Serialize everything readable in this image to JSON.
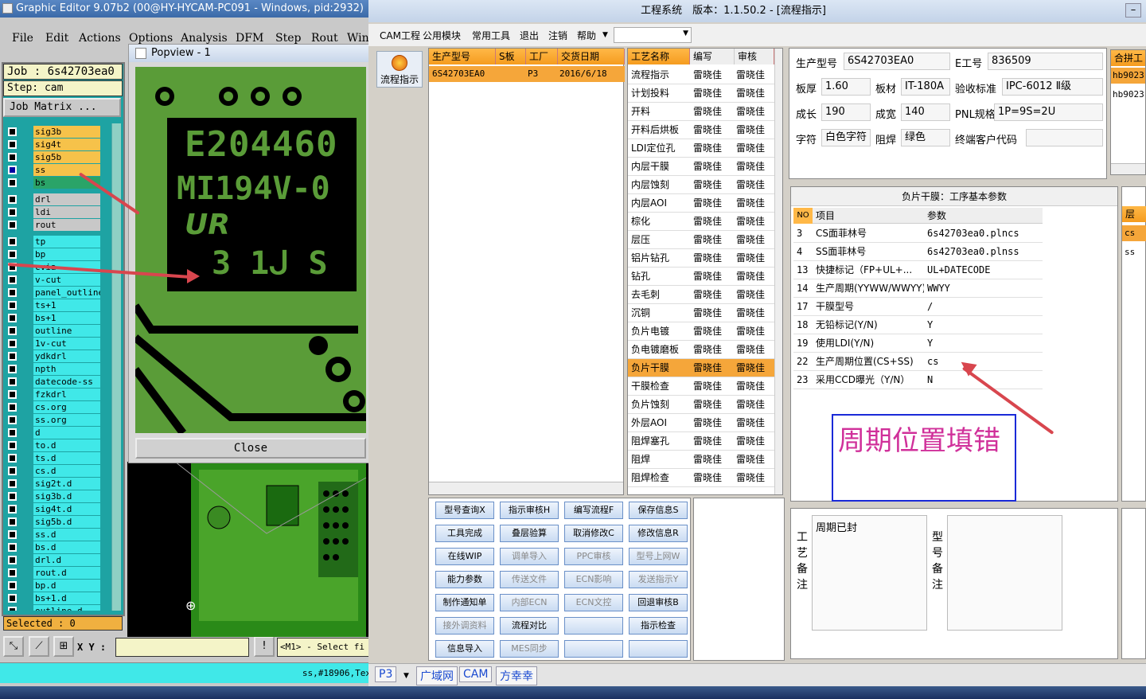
{
  "graphic_editor": {
    "title": "Graphic Editor 9.07b2 (00@HY-HYCAM-PC091 - Windows, pid:2932)",
    "menu": [
      "File",
      "Edit",
      "Actions",
      "Options",
      "Analysis",
      "DFM",
      "Step",
      "Rout",
      "Win"
    ],
    "job_label": "Job : 6s42703ea0",
    "step_label": "Step: cam",
    "matrix_button": "Job Matrix ...",
    "layers": [
      "sig3b",
      "sig4t",
      "sig5b",
      "ss",
      "bs",
      "drl",
      "ldi",
      "rout",
      "tp",
      "bp",
      "cvia",
      "v-cut",
      "panel_outline",
      "ts+1",
      "bs+1",
      "outline",
      "1v-cut",
      "ydkdrl",
      "npth",
      "datecode-ss",
      "fzkdrl",
      "cs.org",
      "ss.org",
      "d",
      "to.d",
      "ts.d",
      "cs.d",
      "sig2t.d",
      "sig3b.d",
      "sig4t.d",
      "sig5b.d",
      "ss.d",
      "bs.d",
      "drl.d",
      "rout.d",
      "bp.d",
      "bs+1.d",
      "outline.d"
    ],
    "selected_text": "Selected : 0",
    "xy_label": "X Y :",
    "message": "<M1> - Select fi",
    "status_text": "ss,#18906,Tex",
    "colors": {
      "layer_yellow": "#f6c24a",
      "layer_gray": "#c8c8c8",
      "layer_cyan": "#40e8e8",
      "layer_green": "#2aa468",
      "cyan_bg": "#1ea3a3"
    }
  },
  "popview": {
    "title": "Popview - 1",
    "close_label": "Close",
    "board_text": [
      "E204460",
      "MI194V-0",
      "UR",
      "3 1ᒍ S"
    ]
  },
  "engineering": {
    "title": "工程系统　版本：1.1.50.2 - [流程指示]",
    "menu": [
      "CAM工程",
      "公用模块",
      "常用工具",
      "退出",
      "注销",
      "帮助"
    ],
    "side_button": "流程指示",
    "order_grid": {
      "headers": [
        "生产型号",
        "S板",
        "工厂",
        "交货日期"
      ],
      "rows": [
        [
          "6S42703EA0",
          "",
          "P3",
          "2016/6/18"
        ]
      ]
    },
    "process_grid": {
      "headers": [
        "工艺名称",
        "编写",
        "审核"
      ],
      "rows": [
        [
          "流程指示",
          "雷晓佳",
          "雷晓佳"
        ],
        [
          "计划投料",
          "雷晓佳",
          "雷晓佳"
        ],
        [
          "开料",
          "雷晓佳",
          "雷晓佳"
        ],
        [
          "开料后烘板",
          "雷晓佳",
          "雷晓佳"
        ],
        [
          "LDI定位孔",
          "雷晓佳",
          "雷晓佳"
        ],
        [
          "内层干膜",
          "雷晓佳",
          "雷晓佳"
        ],
        [
          "内层蚀刻",
          "雷晓佳",
          "雷晓佳"
        ],
        [
          "内层AOI",
          "雷晓佳",
          "雷晓佳"
        ],
        [
          "棕化",
          "雷晓佳",
          "雷晓佳"
        ],
        [
          "层压",
          "雷晓佳",
          "雷晓佳"
        ],
        [
          "铝片钻孔",
          "雷晓佳",
          "雷晓佳"
        ],
        [
          "钻孔",
          "雷晓佳",
          "雷晓佳"
        ],
        [
          "去毛刺",
          "雷晓佳",
          "雷晓佳"
        ],
        [
          "沉铜",
          "雷晓佳",
          "雷晓佳"
        ],
        [
          "负片电镀",
          "雷晓佳",
          "雷晓佳"
        ],
        [
          "负电镀磨板",
          "雷晓佳",
          "雷晓佳"
        ],
        [
          "负片干膜",
          "雷晓佳",
          "雷晓佳"
        ],
        [
          "干膜检查",
          "雷晓佳",
          "雷晓佳"
        ],
        [
          "负片蚀刻",
          "雷晓佳",
          "雷晓佳"
        ],
        [
          "外层AOI",
          "雷晓佳",
          "雷晓佳"
        ],
        [
          "阻焊塞孔",
          "雷晓佳",
          "雷晓佳"
        ],
        [
          "阻焊",
          "雷晓佳",
          "雷晓佳"
        ],
        [
          "阻焊检查",
          "雷晓佳",
          "雷晓佳"
        ]
      ],
      "selected_index": 16
    },
    "buttons": [
      [
        "型号查询X",
        "指示审核H",
        "编写流程F",
        "保存信息S"
      ],
      [
        "工具完成",
        "叠层验算",
        "取消修改C",
        "修改信息R"
      ],
      [
        "在线WIP",
        "调单导入",
        "PPC审核",
        "型号上网W"
      ],
      [
        "能力参数",
        "传送文件",
        "ECN影响",
        "发送指示Y"
      ],
      [
        "制作通知单",
        "内部ECN",
        "ECN文控",
        "回退审核B"
      ],
      [
        "接外调资料",
        "流程对比",
        "",
        "指示检查"
      ],
      [
        "信息导入",
        "MES同步",
        "",
        ""
      ]
    ],
    "disabled_buttons": [
      "调单导入",
      "PPC审核",
      "型号上网W",
      "传送文件",
      "ECN影响",
      "发送指示Y",
      "内部ECN",
      "ECN文控",
      "接外调资料",
      "MES同步"
    ],
    "info": {
      "型号_label": "生产型号",
      "型号": "6S42703EA0",
      "工号_label": "E工号",
      "工号": "836509",
      "板厚_label": "板厚",
      "板厚": "1.60",
      "板材_label": "板材",
      "板材": "IT-180A",
      "验收_label": "验收标准",
      "验收": "IPC-6012 Ⅱ级",
      "成长_label": "成长",
      "成长": "190",
      "成宽_label": "成宽",
      "成宽": "140",
      "pnl_label": "PNL规格",
      "pnl": "1P=9S=2U",
      "字符_label": "字符",
      "字符": "白色字符",
      "阻焊_label": "阻焊",
      "阻焊": "绿色",
      "终端_label": "终端客户代码",
      "终端": ""
    },
    "side_grid": {
      "header": "合拼工",
      "rows": [
        "hb9023",
        "hb9023"
      ]
    },
    "params": {
      "title": "负片干膜：工序基本参数",
      "headers": [
        "NO",
        "项目",
        "参数"
      ],
      "rows": [
        [
          "3",
          "CS面菲林号",
          "6s42703ea0.plncs"
        ],
        [
          "4",
          "SS面菲林号",
          "6s42703ea0.plnss"
        ],
        [
          "13",
          "快捷标记（FP+UL+...",
          "UL+DATECODE"
        ],
        [
          "14",
          "生产周期(YYWW/WWYY)",
          "WWYY"
        ],
        [
          "17",
          "干膜型号",
          "/"
        ],
        [
          "18",
          "无铅标记(Y/N)",
          "Y"
        ],
        [
          "19",
          "使用LDI(Y/N)",
          "Y"
        ],
        [
          "22",
          "生产周期位置(CS+SS)",
          "cs"
        ],
        [
          "23",
          "采用CCD曝光（Y/N）",
          "N"
        ]
      ]
    },
    "side_list": {
      "header": "层",
      "rows": [
        "cs",
        "ss"
      ]
    },
    "annotation": "周期位置填错",
    "remarks": {
      "gy_label": "工艺备注",
      "gy_text": "周期已封",
      "xh_label": "型号备注",
      "xh_text": ""
    },
    "tabs": [
      "P3",
      "广域网",
      "CAM",
      "方幸幸"
    ]
  }
}
